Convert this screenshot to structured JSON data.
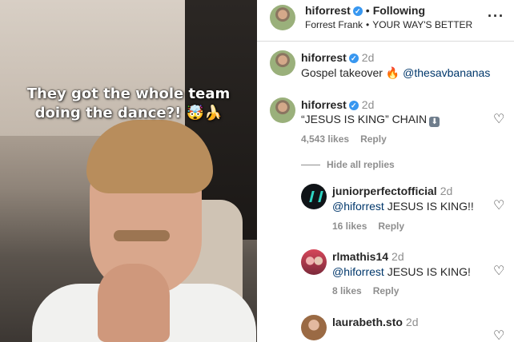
{
  "media": {
    "caption": "They got the whole team doing the dance?! 🤯🍌"
  },
  "post_header": {
    "username": "hiforrest",
    "verified_glyph": "✓",
    "separator": "•",
    "following": "Following",
    "subtitle_artist": "Forrest Frank",
    "subtitle_song": "YOUR WAY'S BETTER",
    "more_glyph": "···"
  },
  "comments": [
    {
      "username": "hiforrest",
      "time": "2d",
      "text": "Gospel takeover 🔥",
      "mention": "@thesavbananas"
    },
    {
      "username": "hiforrest",
      "time": "2d",
      "text": "“JESUS IS KING” CHAIN",
      "emoji": "⬇",
      "likes": "4,543 likes",
      "reply": "Reply"
    }
  ],
  "hide_replies": "Hide all replies",
  "replies": [
    {
      "username": "juniorperfectofficial",
      "time": "2d",
      "mention": "@hiforrest",
      "text": "JESUS IS KING!!",
      "likes": "16 likes",
      "reply": "Reply"
    },
    {
      "username": "rlmathis14",
      "time": "2d",
      "mention": "@hiforrest",
      "text": "JESUS IS KING!",
      "likes": "8 likes",
      "reply": "Reply"
    },
    {
      "username": "laurabeth.sto",
      "time": "2d"
    }
  ],
  "heart_glyph": "♡",
  "icons": [
    "verified-badge-icon",
    "heart-icon",
    "more-options-icon",
    "down-arrow-emoji-icon"
  ],
  "colors": {
    "verified": "#3897f0",
    "mention": "#00376b",
    "muted": "#8e8e8e"
  }
}
